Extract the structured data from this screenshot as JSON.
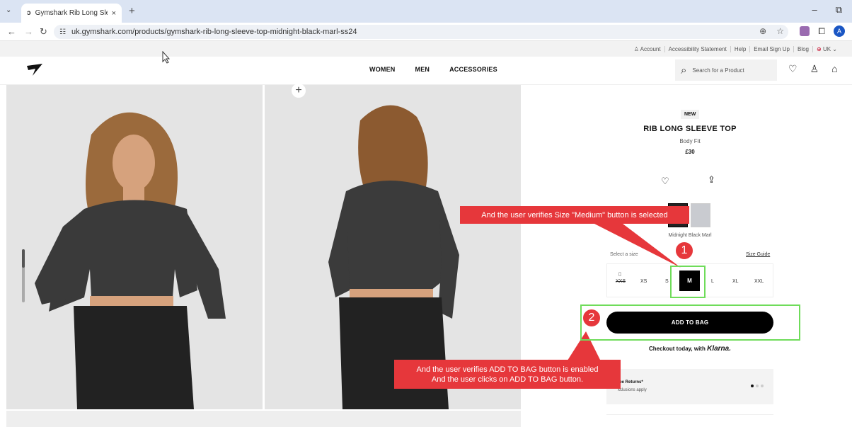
{
  "browser": {
    "tab_title": "Gymshark Rib Long Sleeve Top",
    "tab_close": "×",
    "new_tab": "+",
    "url": "uk.gymshark.com/products/gymshark-rib-long-sleeve-top-midnight-black-marl-ss24",
    "profile_initial": "A"
  },
  "utility_nav": [
    {
      "label": "Account"
    },
    {
      "label": "Accessibility Statement"
    },
    {
      "label": "Help"
    },
    {
      "label": "Email Sign Up"
    },
    {
      "label": "Blog"
    },
    {
      "label": "UK"
    }
  ],
  "header": {
    "nav": [
      "WOMEN",
      "MEN",
      "ACCESSORIES"
    ],
    "search_placeholder": "Search for a Product"
  },
  "product": {
    "badge": "NEW",
    "title": "RIB LONG SLEEVE TOP",
    "fit": "Body Fit",
    "price": "£30",
    "color_name": "Midnight Black Marl",
    "select_size_label": "Select a size",
    "size_guide": "Size Guide",
    "sizes": [
      "XXS",
      "XS",
      "S",
      "M",
      "L",
      "XL",
      "XXL"
    ],
    "selected_size": "M",
    "add_to_bag": "ADD TO BAG",
    "checkout_text": "Checkout today, with",
    "checkout_brand": "Klarna.",
    "returns_title": "ree Returns*",
    "returns_sub": "xclusions apply"
  },
  "annotations": {
    "step1_number": "1",
    "step1_text": "And the user verifies Size \"Medium\" button is selected",
    "step2_number": "2",
    "step2_line1": "And the user verifies ADD TO BAG button is enabled",
    "step2_line2": "And the user clicks on ADD TO BAG button."
  },
  "colors": {
    "annotation_red": "#e6373b",
    "highlight_green": "#6fdc5a",
    "brand_black": "#000000"
  }
}
